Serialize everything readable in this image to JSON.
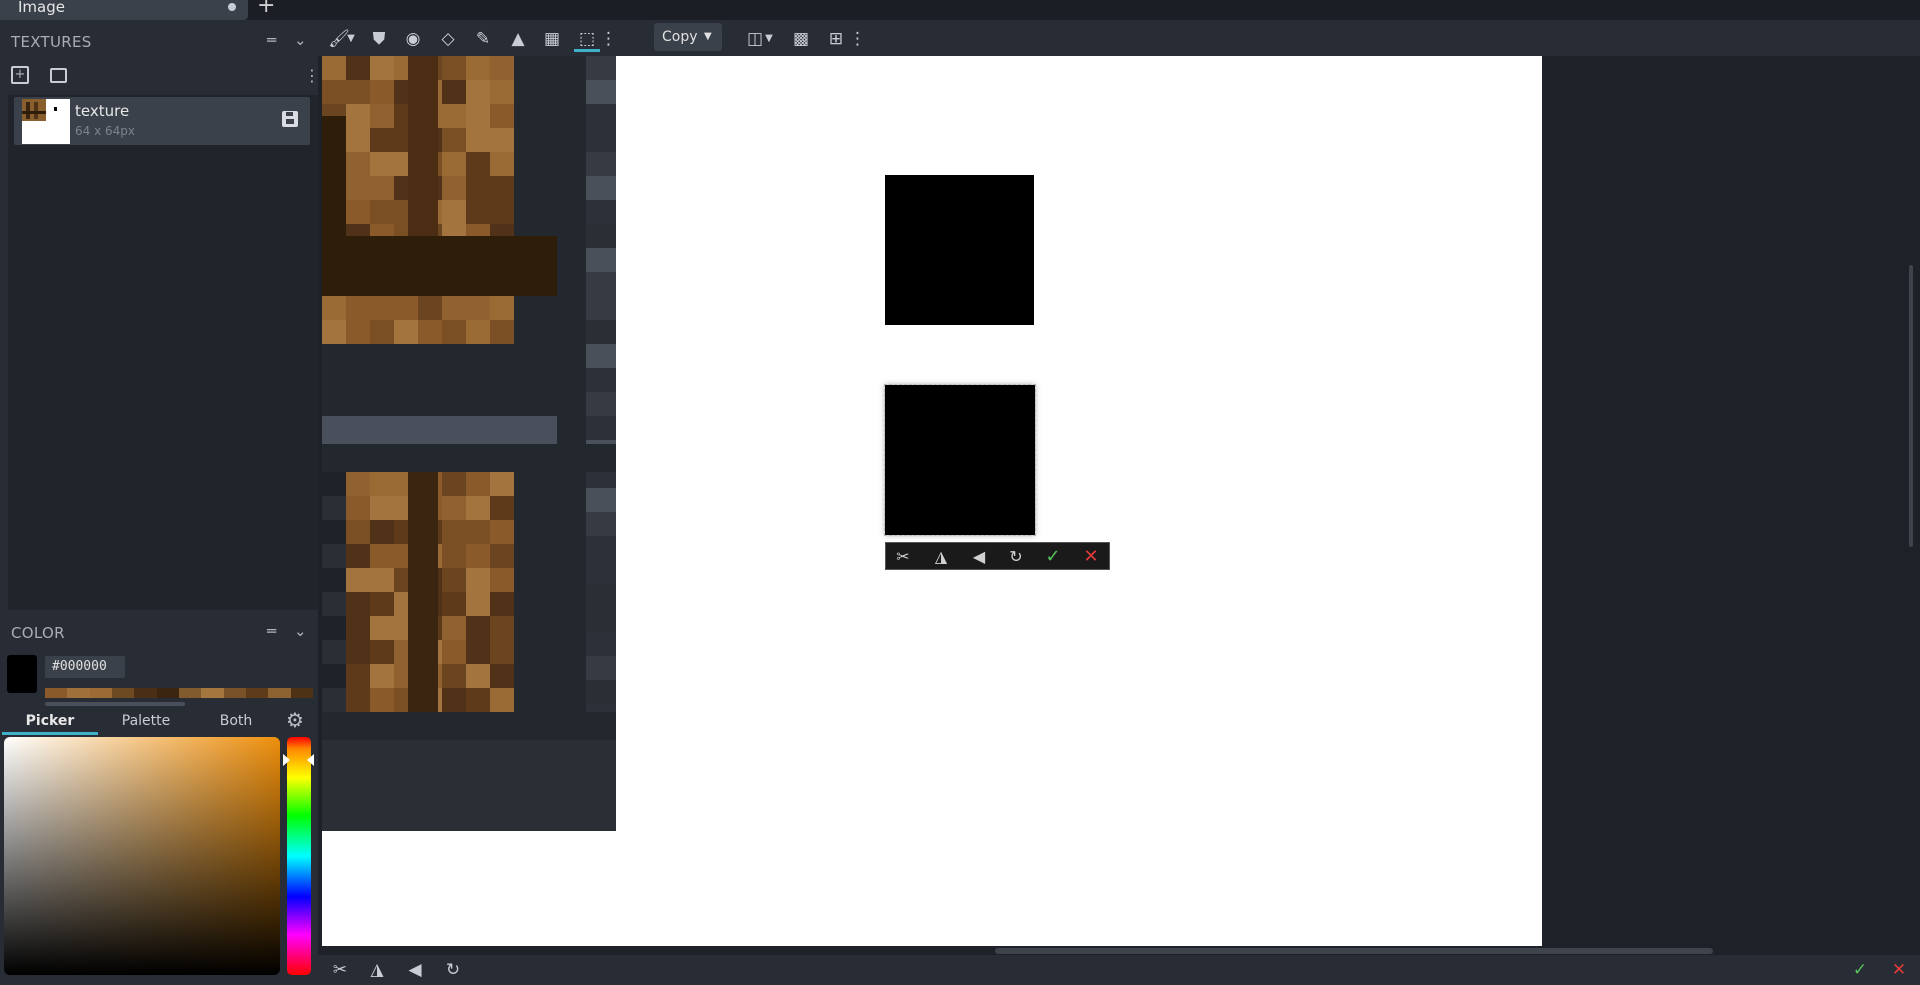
{
  "document_tab": {
    "title": "Image",
    "add_label": "+"
  },
  "textures_panel": {
    "title": "TEXTURES",
    "items": [
      {
        "name": "texture",
        "size": "64 x 64px"
      }
    ]
  },
  "color_panel": {
    "title": "COLOR",
    "hex": "#000000",
    "current_color": "#000000",
    "tabs": [
      {
        "label": "Picker",
        "active": true
      },
      {
        "label": "Palette"
      },
      {
        "label": "Both"
      }
    ],
    "hue_color": "#ee8f0c",
    "recent_colors": [
      "#8b5a2b",
      "#a0703a",
      "#9c6b35",
      "#6e4a22",
      "#4a2f14",
      "#3c2510",
      "#815a2d",
      "#a3773e",
      "#7a5227",
      "#5e3c19",
      "#8c6231",
      "#4d3216"
    ]
  },
  "toolbar": {
    "tools": [
      "brush-icon",
      "stamp-icon",
      "fill-icon",
      "eraser-icon",
      "eyedropper-icon",
      "shapes-icon",
      "gradient-icon",
      "transform-icon"
    ],
    "selected_tool": "transform-icon",
    "copy_mode": "Copy"
  },
  "floating_toolbar": {
    "actions": [
      "cut-icon",
      "flip-horizontal-icon",
      "flip-vertical-icon",
      "rotate-icon",
      "confirm-icon",
      "cancel-icon"
    ]
  },
  "bottom_bar": {
    "actions": [
      "cut-icon",
      "flip-horizontal-icon",
      "flip-vertical-icon",
      "rotate-icon"
    ],
    "confirm": "confirm-icon",
    "cancel": "cancel-icon"
  }
}
